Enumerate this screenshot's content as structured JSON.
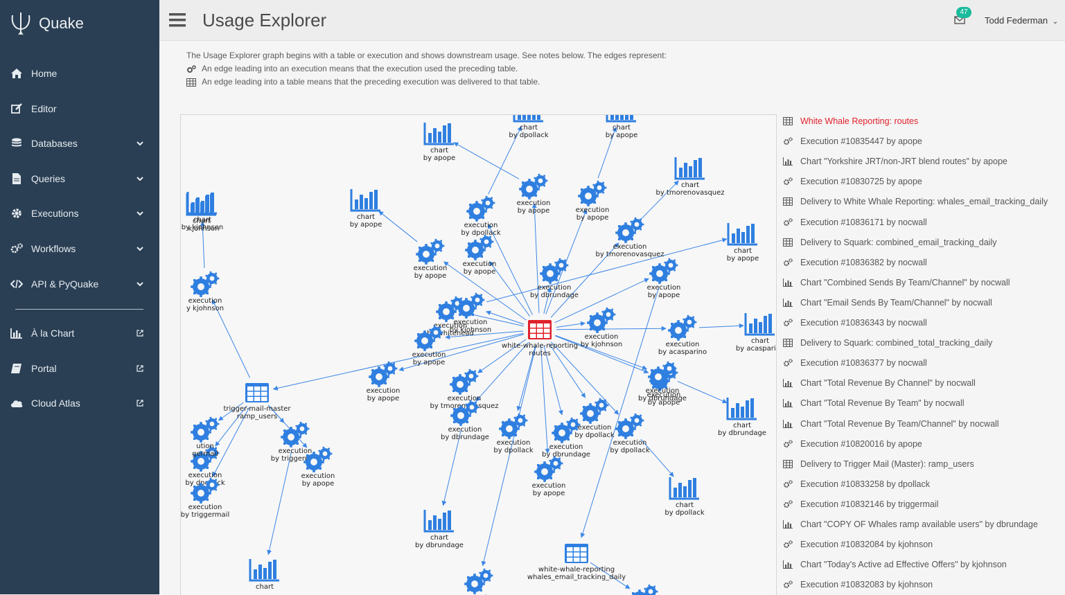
{
  "app": {
    "name": "Quake"
  },
  "nav": {
    "items": [
      {
        "label": "Home",
        "icon": "home-icon",
        "has_chevron": false
      },
      {
        "label": "Editor",
        "icon": "edit-icon",
        "has_chevron": false
      },
      {
        "label": "Databases",
        "icon": "database-icon",
        "has_chevron": true
      },
      {
        "label": "Queries",
        "icon": "file-icon",
        "has_chevron": true
      },
      {
        "label": "Executions",
        "icon": "gear-icon",
        "has_chevron": true
      },
      {
        "label": "Workflows",
        "icon": "gears-icon",
        "has_chevron": true
      },
      {
        "label": "API & PyQuake",
        "icon": "code-icon",
        "has_chevron": true
      }
    ],
    "external": [
      {
        "label": "À la Chart",
        "icon": "bar-chart-icon"
      },
      {
        "label": "Portal",
        "icon": "book-icon"
      },
      {
        "label": "Cloud Atlas",
        "icon": "cloud-icon"
      }
    ]
  },
  "header": {
    "title": "Usage Explorer",
    "notifications": "47",
    "user": "Todd Federman"
  },
  "intro": {
    "text": "The Usage Explorer graph begins with a table or execution and shows downstream usage. See notes below. The edges represent:",
    "note_execution": "An edge leading into an execution means that the execution used the preceding table.",
    "note_table": "An edge leading into a table means that the preceding execution was delivered to that table."
  },
  "colors": {
    "sidebar": "#2a3f54",
    "node": "#2f7fe0",
    "root": "#e0212b",
    "badge": "#1abb9c",
    "edge": "#3b86e6"
  },
  "graph": {
    "nodes": [
      {
        "type": "table",
        "l1": "white-whale-reporting",
        "l2": "routes",
        "root": true
      },
      {
        "type": "chart",
        "l1": "chart",
        "l2": "by dpollack"
      },
      {
        "type": "chart",
        "l1": "chart",
        "l2": "by apope"
      },
      {
        "type": "chart",
        "l1": "chart",
        "l2": "by apope"
      },
      {
        "type": "chart",
        "l1": "chart",
        "l2": "by tmorenovasquez"
      },
      {
        "type": "execution",
        "l1": "execution",
        "l2": "by dpollack"
      },
      {
        "type": "execution",
        "l1": "execution",
        "l2": "by apope"
      },
      {
        "type": "execution",
        "l1": "execution",
        "l2": "by apope"
      },
      {
        "type": "chart",
        "l1": "chart",
        "l2": "by apope"
      },
      {
        "type": "chart",
        "l1": "chart",
        "l2": "by kjohnson"
      },
      {
        "type": "execution",
        "l1": "execution",
        "l2": "by tmorenovasquez"
      },
      {
        "type": "chart",
        "l1": "chart",
        "l2": "by apope"
      },
      {
        "type": "execution",
        "l1": "execution",
        "l2": "by apope"
      },
      {
        "type": "execution",
        "l1": "execution",
        "l2": "by apope"
      },
      {
        "type": "execution",
        "l1": "execution",
        "l2": "by dbrundage"
      },
      {
        "type": "execution",
        "l1": "execution",
        "l2": "by apope"
      },
      {
        "type": "execution",
        "l1": "execution",
        "l2": "by kjohnson"
      },
      {
        "type": "execution",
        "l1": "execution",
        "l2": "by whitehead"
      },
      {
        "type": "execution",
        "l1": "execution",
        "l2": "by apope"
      },
      {
        "type": "execution",
        "l1": "execution",
        "l2": "by kjohnson"
      },
      {
        "type": "execution",
        "l1": "execution",
        "l2": "by acasparino"
      },
      {
        "type": "chart",
        "l1": "chart",
        "l2": "by acasparino"
      },
      {
        "type": "execution",
        "l1": "execution",
        "l2": "by apope"
      },
      {
        "type": "execution",
        "l1": "execution",
        "l2": "by triggermail"
      },
      {
        "type": "table",
        "l1": "trigger-mail-master",
        "l2": "ramp_users"
      },
      {
        "type": "execution",
        "l1": "execution",
        "l2": "by apope"
      },
      {
        "type": "execution",
        "l1": "execution",
        "l2": "by tmorenovasquez"
      },
      {
        "type": "execution",
        "l1": "execution",
        "l2": "by dbrundage"
      },
      {
        "type": "chart",
        "l1": "chart",
        "l2": "by dbrundage"
      },
      {
        "type": "execution",
        "l1": "execution",
        "l2": "by dpollack"
      },
      {
        "type": "execution",
        "l1": "execution",
        "l2": "by dpollack"
      },
      {
        "type": "execution",
        "l1": "execution",
        "l2": "by apope"
      },
      {
        "type": "execution",
        "l1": "execution",
        "l2": "by dbrundage"
      },
      {
        "type": "execution",
        "l1": "execution",
        "l2": "by dpollack"
      },
      {
        "type": "chart",
        "l1": "chart",
        "l2": "by dpollack"
      },
      {
        "type": "execution",
        "l1": "execution",
        "l2": "by dbrundage"
      },
      {
        "type": "chart",
        "l1": "chart",
        "l2": "by dbrundage"
      },
      {
        "type": "execution",
        "l1": "execution",
        "l2": "by apope"
      },
      {
        "type": "table",
        "l1": "white-whale-reporting",
        "l2": "whales_email_tracking_daily"
      },
      {
        "type": "execution",
        "l1": "execution",
        "l2": "by apope"
      },
      {
        "type": "execution",
        "l1": "execution",
        "l2": "by dpollack"
      },
      {
        "type": "execution",
        "l1": "execution",
        "l2": "by triggermail"
      },
      {
        "type": "chart",
        "l1": "chart",
        "l2": ""
      },
      {
        "type": "execution",
        "l1": "ution",
        "l2": "germail"
      },
      {
        "type": "execution",
        "l1": "execution",
        "l2": "y kjohnson"
      },
      {
        "type": "chart",
        "l1": "chart",
        "l2": "' kjohnson"
      },
      {
        "type": "execution",
        "l1": "",
        "l2": ""
      }
    ],
    "edges": [
      [
        0,
        5
      ],
      [
        0,
        6
      ],
      [
        0,
        7
      ],
      [
        0,
        10
      ],
      [
        0,
        12
      ],
      [
        0,
        13
      ],
      [
        0,
        14
      ],
      [
        0,
        15
      ],
      [
        0,
        16
      ],
      [
        0,
        17
      ],
      [
        0,
        18
      ],
      [
        0,
        19
      ],
      [
        0,
        20
      ],
      [
        0,
        22
      ],
      [
        0,
        24
      ],
      [
        0,
        25
      ],
      [
        0,
        26
      ],
      [
        0,
        27
      ],
      [
        0,
        29
      ],
      [
        0,
        30
      ],
      [
        0,
        31
      ],
      [
        0,
        32
      ],
      [
        0,
        33
      ],
      [
        0,
        35
      ],
      [
        0,
        37
      ],
      [
        5,
        1
      ],
      [
        6,
        2
      ],
      [
        7,
        3
      ],
      [
        10,
        4
      ],
      [
        12,
        8
      ],
      [
        19,
        11
      ],
      [
        20,
        21
      ],
      [
        15,
        38
      ],
      [
        24,
        23
      ],
      [
        24,
        39
      ],
      [
        24,
        40
      ],
      [
        24,
        41
      ],
      [
        24,
        43
      ],
      [
        24,
        44
      ],
      [
        44,
        45
      ],
      [
        23,
        42
      ],
      [
        27,
        28
      ],
      [
        35,
        36
      ],
      [
        33,
        34
      ],
      [
        38,
        46
      ]
    ]
  },
  "items": [
    {
      "icon": "table-icon",
      "text": "White Whale Reporting: routes",
      "active": true
    },
    {
      "icon": "gears-icon",
      "text": "Execution #10835447 by apope"
    },
    {
      "icon": "bar-chart-icon",
      "text": "Chart \"Yorkshire JRT/non-JRT blend routes\" by apope"
    },
    {
      "icon": "gears-icon",
      "text": "Execution #10830725 by apope"
    },
    {
      "icon": "table-icon",
      "text": "Delivery to White Whale Reporting: whales_email_tracking_daily"
    },
    {
      "icon": "gears-icon",
      "text": "Execution #10836171 by nocwall"
    },
    {
      "icon": "table-icon",
      "text": "Delivery to Squark: combined_email_tracking_daily"
    },
    {
      "icon": "gears-icon",
      "text": "Execution #10836382 by nocwall"
    },
    {
      "icon": "bar-chart-icon",
      "text": "Chart \"Combined Sends By Team/Channel\" by nocwall"
    },
    {
      "icon": "bar-chart-icon",
      "text": "Chart \"Email Sends By Team/Channel\" by nocwall"
    },
    {
      "icon": "gears-icon",
      "text": "Execution #10836343 by nocwall"
    },
    {
      "icon": "table-icon",
      "text": "Delivery to Squark: combined_total_tracking_daily"
    },
    {
      "icon": "gears-icon",
      "text": "Execution #10836377 by nocwall"
    },
    {
      "icon": "bar-chart-icon",
      "text": "Chart \"Total Revenue By Channel\" by nocwall"
    },
    {
      "icon": "bar-chart-icon",
      "text": "Chart \"Total Revenue By Team\" by nocwall"
    },
    {
      "icon": "bar-chart-icon",
      "text": "Chart \"Total Revenue By Team/Channel\" by nocwall"
    },
    {
      "icon": "gears-icon",
      "text": "Execution #10820016 by apope"
    },
    {
      "icon": "table-icon",
      "text": "Delivery to Trigger Mail (Master): ramp_users"
    },
    {
      "icon": "gears-icon",
      "text": "Execution #10833258 by dpollack"
    },
    {
      "icon": "gears-icon",
      "text": "Execution #10832146 by triggermail"
    },
    {
      "icon": "bar-chart-icon",
      "text": "Chart \"COPY OF Whales ramp available users\" by dbrundage"
    },
    {
      "icon": "gears-icon",
      "text": "Execution #10832084 by kjohnson"
    },
    {
      "icon": "bar-chart-icon",
      "text": "Chart \"Today's Active ad Effective Offers\" by kjohnson"
    },
    {
      "icon": "gears-icon",
      "text": "Execution #10832083 by kjohnson"
    }
  ]
}
